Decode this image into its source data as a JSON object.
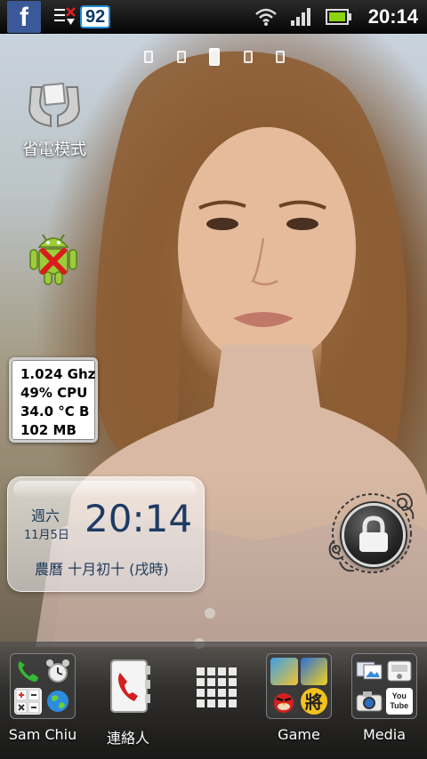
{
  "status_bar": {
    "facebook_glyph": "f",
    "battery_badge": "92",
    "time": "20:14",
    "icons": [
      "facebook-icon",
      "notification-icon",
      "wifi-icon",
      "signal-icon",
      "battery-icon"
    ]
  },
  "home": {
    "page_count": 5,
    "current_page": 3,
    "power_save_label": "省電模式",
    "cpu_widget": {
      "freq": "1.024 Ghz",
      "cpu": "49% CPU",
      "temp": "34.0 °C B",
      "mem": "102 MB"
    },
    "clock": {
      "weekday": "週六",
      "date": "11月5日",
      "time": "20:14",
      "lunar": "農曆 十月初十 (戌時)"
    }
  },
  "dock": {
    "items": [
      {
        "label": "Sam Chiu"
      },
      {
        "label": "連絡人"
      },
      {
        "label": ""
      },
      {
        "label": "Game"
      },
      {
        "label": "Media"
      }
    ],
    "game_folder_badge": "將",
    "media_folder_badge": "You Tube"
  },
  "colors": {
    "facebook": "#3b5998",
    "battery_badge_border": "#1e8cd8",
    "clock_text": "#1d3b63"
  }
}
